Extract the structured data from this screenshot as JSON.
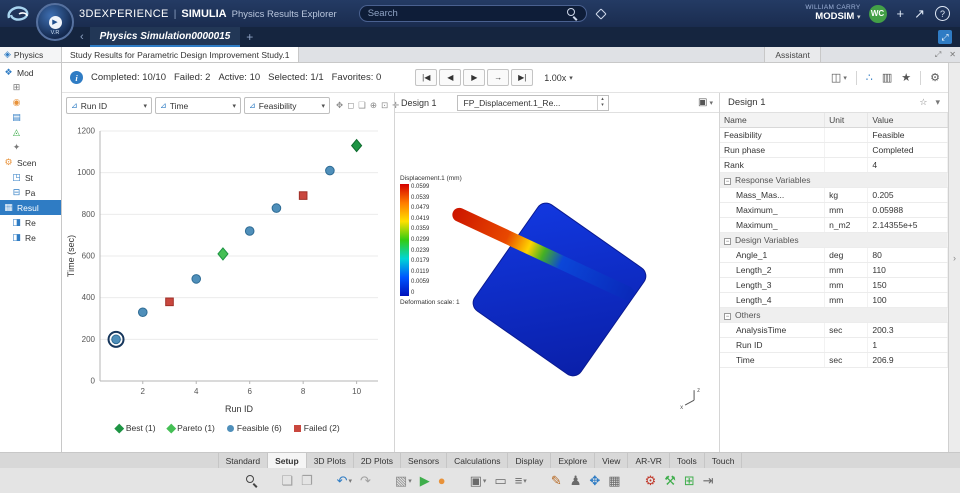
{
  "icons": {
    "gear": "⚙",
    "star": "★",
    "star_outline": "☆",
    "plus": "+",
    "share": "↗",
    "help": "?",
    "chevron_down": "▾",
    "chevron_left": "‹",
    "chevron_right": "›",
    "expand": "⤢",
    "close": "✕",
    "info": "i",
    "physics": "◈",
    "image": "▣",
    "spin_up": "▴",
    "spin_down": "▾",
    "play": "▶"
  },
  "topbar": {
    "brand": "3DEXPERIENCE",
    "divider": "|",
    "app": "SIMULIA",
    "app_desc": "Physics Results Explorer",
    "search_placeholder": "Search",
    "user_name": "WILLIAM CARRY",
    "workspace": "MODSIM",
    "avatar_initials": "WC",
    "compass_label": "V.R"
  },
  "tabbar": {
    "document_tab": "Physics Simulation0000015",
    "new_tab": "+"
  },
  "panel_tabs": {
    "left_header": "Physics",
    "main_tab": "Study Results for Parametric Design Improvement Study.1",
    "assistant_tab": "Assistant"
  },
  "tree": {
    "items": [
      {
        "label": "Mod",
        "icon": "model",
        "glyph": "❖",
        "color": "#2f7cc4",
        "child": false,
        "selected": false
      },
      {
        "label": "",
        "icon": "node-grid",
        "glyph": "⊞",
        "color": "#7a7a7a",
        "child": true,
        "selected": false
      },
      {
        "label": "",
        "icon": "node-target",
        "glyph": "◉",
        "color": "#e8923a",
        "child": true,
        "selected": false
      },
      {
        "label": "",
        "icon": "node-layers",
        "glyph": "▤",
        "color": "#2f7cc4",
        "child": true,
        "selected": false
      },
      {
        "label": "",
        "icon": "node-triangle",
        "glyph": "◬",
        "color": "#3fae4c",
        "child": true,
        "selected": false
      },
      {
        "label": "",
        "icon": "node-spark",
        "glyph": "✦",
        "color": "#7a7a7a",
        "child": true,
        "selected": false
      },
      {
        "label": "Scen",
        "icon": "scenario",
        "glyph": "⚙",
        "color": "#e8923a",
        "child": false,
        "selected": false
      },
      {
        "label": "St",
        "icon": "study",
        "glyph": "◳",
        "color": "#2f7cc4",
        "child": true,
        "selected": false
      },
      {
        "label": "Pa",
        "icon": "parameters",
        "glyph": "⊟",
        "color": "#2f7cc4",
        "child": true,
        "selected": false
      },
      {
        "label": "Resul",
        "icon": "results",
        "glyph": "▦",
        "color": "#ffffff",
        "child": false,
        "selected": true
      },
      {
        "label": "Re",
        "icon": "result",
        "glyph": "◨",
        "color": "#2f7cc4",
        "child": true,
        "selected": false
      },
      {
        "label": "Re",
        "icon": "result",
        "glyph": "◨",
        "color": "#2f7cc4",
        "child": true,
        "selected": false
      }
    ]
  },
  "statusbar": {
    "completed": "Completed: 10/10",
    "failed": "Failed: 2",
    "active": "Active: 10",
    "selected": "Selected: 1/1",
    "favorites": "Favorites: 0",
    "speed": "1.00x"
  },
  "playback": {
    "buttons": [
      {
        "name": "skip-start-button",
        "glyph": "|◀"
      },
      {
        "name": "step-back-button",
        "glyph": "◀"
      },
      {
        "name": "play-button",
        "glyph": "▶"
      },
      {
        "name": "step-forward-button",
        "glyph": "→"
      },
      {
        "name": "skip-end-button",
        "glyph": "▶|"
      }
    ]
  },
  "toolbar_right": [
    {
      "name": "layout-panes-icon",
      "glyph": "◫",
      "caret": true
    },
    {
      "sep": true
    },
    {
      "name": "scatter-plot-icon",
      "glyph": "∴",
      "active": true
    },
    {
      "name": "columns-icon",
      "glyph": "▥"
    },
    {
      "name": "favorites-star-icon",
      "glyph": "★"
    },
    {
      "sep": true
    },
    {
      "name": "settings-gear-icon",
      "glyph": "⚙"
    }
  ],
  "chart_panel": {
    "filters": [
      {
        "label": "Run ID",
        "icon_glyph": "⊿"
      },
      {
        "label": "Time",
        "icon_glyph": "⊿"
      },
      {
        "label": "Feasibility",
        "icon_glyph": "⊿"
      }
    ],
    "tools": [
      {
        "name": "pan-icon",
        "glyph": "✥"
      },
      {
        "name": "box-select-icon",
        "glyph": "◻"
      },
      {
        "name": "comment-icon",
        "glyph": "❑"
      },
      {
        "name": "zoom-in-icon",
        "glyph": "⊕"
      },
      {
        "name": "fit-view-icon",
        "glyph": "⊡"
      },
      {
        "name": "crosshair-icon",
        "glyph": "✛"
      }
    ]
  },
  "chart_data": {
    "type": "scatter",
    "title": "",
    "xlabel": "Run ID",
    "ylabel": "Time (sec)",
    "xlim": [
      0.4,
      10.8
    ],
    "ylim": [
      0,
      1200
    ],
    "x_ticks": [
      2,
      4,
      6,
      8,
      10
    ],
    "y_ticks": [
      0,
      200,
      400,
      600,
      800,
      1000,
      1200
    ],
    "grid": true,
    "legend_position": "bottom",
    "series": [
      {
        "name": "Best (1)",
        "marker": "diamond",
        "color": "#1e9444",
        "edge": "#0e6b2e",
        "points": [
          {
            "x": 10,
            "y": 1130
          }
        ]
      },
      {
        "name": "Pareto (1)",
        "marker": "diamond",
        "color": "#45bf55",
        "edge": "#1e9444",
        "points": [
          {
            "x": 5,
            "y": 610
          }
        ]
      },
      {
        "name": "Feasible (6)",
        "marker": "circle",
        "color": "#4f8fba",
        "edge": "#2e6b94",
        "points": [
          {
            "x": 1,
            "y": 200,
            "selected": true
          },
          {
            "x": 2,
            "y": 330
          },
          {
            "x": 4,
            "y": 490
          },
          {
            "x": 6,
            "y": 720
          },
          {
            "x": 7,
            "y": 830
          },
          {
            "x": 9,
            "y": 1010
          }
        ]
      },
      {
        "name": "Failed (2)",
        "marker": "square",
        "color": "#c9473e",
        "edge": "#a03028",
        "points": [
          {
            "x": 3,
            "y": 380
          },
          {
            "x": 8,
            "y": 890
          }
        ]
      }
    ]
  },
  "viewer": {
    "design_label": "Design 1",
    "plot_selector": "FP_Displacement.1_Re...",
    "colorbar": {
      "title": "Displacement.1 (mm)",
      "labels": [
        "0.0599",
        "0.0539",
        "0.0479",
        "0.0419",
        "0.0359",
        "0.0299",
        "0.0239",
        "0.0179",
        "0.0119",
        "0.0059",
        "0"
      ],
      "footer": "Deformation scale: 1"
    },
    "axis_triad": {
      "up": "z",
      "side": "x"
    }
  },
  "properties": {
    "title": "Design 1",
    "columns": [
      "Name",
      "Unit",
      "Value"
    ],
    "rows": [
      {
        "type": "row",
        "name": "Feasibility",
        "unit": "",
        "value": "Feasible"
      },
      {
        "type": "row",
        "name": "Run phase",
        "unit": "",
        "value": "Completed"
      },
      {
        "type": "row",
        "name": "Rank",
        "unit": "",
        "value": "4"
      },
      {
        "type": "section",
        "name": "Response Variables"
      },
      {
        "type": "child",
        "name": "Mass_Mas...",
        "unit": "kg",
        "value": "0.205"
      },
      {
        "type": "child",
        "name": "Maximum_",
        "unit": "mm",
        "value": "0.05988"
      },
      {
        "type": "child",
        "name": "Maximum_",
        "unit": "n_m2",
        "value": "2.14355e+5"
      },
      {
        "type": "section",
        "name": "Design Variables"
      },
      {
        "type": "child",
        "name": "Angle_1",
        "unit": "deg",
        "value": "80"
      },
      {
        "type": "child",
        "name": "Length_2",
        "unit": "mm",
        "value": "110"
      },
      {
        "type": "child",
        "name": "Length_3",
        "unit": "mm",
        "value": "150"
      },
      {
        "type": "child",
        "name": "Length_4",
        "unit": "mm",
        "value": "100"
      },
      {
        "type": "section",
        "name": "Others"
      },
      {
        "type": "child",
        "name": "AnalysisTime",
        "unit": "sec",
        "value": "200.3"
      },
      {
        "type": "child",
        "name": "Run ID",
        "unit": "",
        "value": "1"
      },
      {
        "type": "child",
        "name": "Time",
        "unit": "sec",
        "value": "206.9"
      }
    ]
  },
  "ribbon": {
    "active": "Setup",
    "tabs": [
      "Standard",
      "Setup",
      "3D Plots",
      "2D Plots",
      "Sensors",
      "Calculations",
      "Display",
      "Explore",
      "View",
      "AR-VR",
      "Tools",
      "Touch"
    ]
  },
  "bottom_toolbar": [
    {
      "name": "zoom",
      "type": "mag"
    },
    {
      "gap": true
    },
    {
      "name": "copy",
      "glyph": "❏",
      "color": "#a0a0a0"
    },
    {
      "name": "paste",
      "glyph": "❐",
      "color": "#a0a0a0"
    },
    {
      "gap": true
    },
    {
      "name": "undo",
      "glyph": "↶",
      "color": "#2f7cc4",
      "caret": true
    },
    {
      "name": "redo",
      "glyph": "↷",
      "color": "#a0a0a0"
    },
    {
      "gap": true
    },
    {
      "name": "model-view",
      "glyph": "▧",
      "color": "#8a8a8a",
      "caret": true
    },
    {
      "name": "play-simulation",
      "glyph": "▶",
      "color": "#3fae4c"
    },
    {
      "name": "results-sphere",
      "glyph": "●",
      "color": "#e8923a"
    },
    {
      "gap": true
    },
    {
      "name": "capture",
      "glyph": "▣",
      "color": "#6a6a6a",
      "caret": true
    },
    {
      "name": "display-screen",
      "glyph": "▭",
      "color": "#6a6a6a"
    },
    {
      "name": "list-view",
      "glyph": "≡",
      "color": "#6a6a6a",
      "caret": true
    },
    {
      "gap": true
    },
    {
      "name": "sketch",
      "glyph": "✎",
      "color": "#b5651d"
    },
    {
      "name": "manikin",
      "glyph": "♟",
      "color": "#6a6a6a"
    },
    {
      "name": "transform",
      "glyph": "✥",
      "color": "#2f7cc4"
    },
    {
      "name": "plot",
      "glyph": "▦",
      "color": "#6a6a6a"
    },
    {
      "gap": true
    },
    {
      "name": "settings-red",
      "glyph": "⚙",
      "color": "#c0392b"
    },
    {
      "name": "tools-wrench",
      "glyph": "⚒",
      "color": "#3fae4c"
    },
    {
      "name": "data-table",
      "glyph": "⊞",
      "color": "#3fae4c"
    },
    {
      "name": "export",
      "glyph": "⇥",
      "color": "#6a6a6a"
    }
  ],
  "colors": {
    "accent": "#2f7cc4",
    "topbar_bg": "#1a2c4f",
    "selected_row": "#2f7cc4",
    "feasible": "#4f8fba",
    "failed": "#c9473e",
    "best": "#1e9444",
    "pareto": "#45bf55",
    "avatar_green": "#43a047"
  }
}
